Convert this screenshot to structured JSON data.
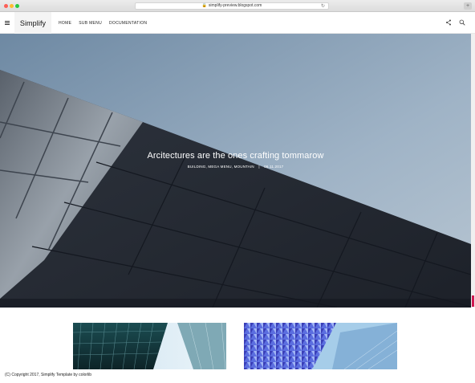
{
  "browser": {
    "url": "simplify-preview.blogspot.com"
  },
  "header": {
    "logo": "Simplify",
    "nav": [
      "HOME",
      "SUB MENU",
      "DOCUMENTATION"
    ]
  },
  "hero": {
    "title": "Arcitectures are the ones crafting tommarow",
    "labels": "BUILDING, MEGA MENU, MOUNTAIN",
    "separator": "|",
    "date": "06.11.2017"
  },
  "footer": {
    "copyright": "(C) Copyright 2017, Simplify Template by colorlib"
  },
  "colors": {
    "accent": "#d01a52",
    "sky": "#8aa3bb",
    "facade": "#2a303a"
  }
}
